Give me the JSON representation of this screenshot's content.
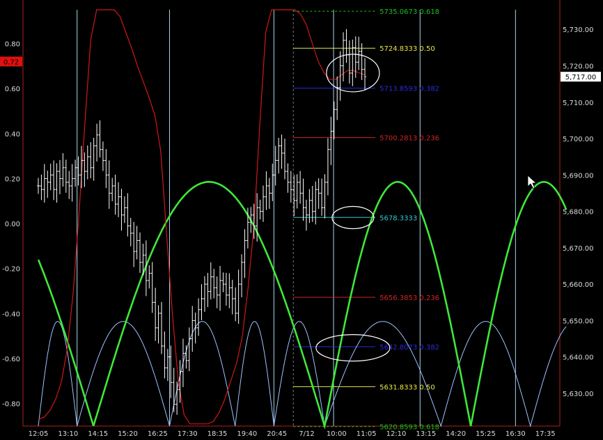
{
  "chart_data": {
    "type": "line",
    "x_tick_labels": [
      "12:05",
      "13:10",
      "14:15",
      "15:20",
      "16:25",
      "17:30",
      "18:35",
      "19:40",
      "20:45",
      "7/12",
      "10:00",
      "11:05",
      "12:10",
      "13:15",
      "14:20",
      "15:25",
      "16:30",
      "17:35"
    ],
    "left_axis": {
      "ticks": [
        -0.8,
        -0.6,
        -0.4,
        -0.2,
        0.0,
        0.2,
        0.4,
        0.6,
        0.8
      ],
      "tick_labels": [
        "-0.80",
        "-0.60",
        "-0.40",
        "-0.20",
        "0.00",
        "0.20",
        "0.40",
        "0.60",
        "0.80"
      ],
      "ylim": [
        -0.9,
        0.95
      ],
      "current_marker": "0.72"
    },
    "right_axis": {
      "ticks": [
        5630,
        5640,
        5650,
        5660,
        5670,
        5680,
        5690,
        5700,
        5710,
        5720,
        5730
      ],
      "tick_labels": [
        "5,630.00",
        "5,640.00",
        "5,650.00",
        "5,660.00",
        "5,670.00",
        "5,680.00",
        "5,690.00",
        "5,700.00",
        "5,710.00",
        "5,720.00",
        "5,730.00"
      ],
      "ylim": [
        5621.0,
        5735.4
      ],
      "current_price_label": "5,717.00",
      "current_price": 5717.0
    },
    "fib_levels": [
      {
        "price": 5735.0,
        "label": "5735.0673 0.618",
        "color": "#19c219",
        "dashed": true
      },
      {
        "price": 5724.8333,
        "label": "5724.8333 0.50",
        "color": "#e8e84a",
        "dashed": false
      },
      {
        "price": 5713.8593,
        "label": "5713.8593 0.382",
        "color": "#2b2bd9",
        "dashed": false
      },
      {
        "price": 5700.2813,
        "label": "5700.2813 0.236",
        "color": "#d42424",
        "dashed": false
      },
      {
        "price": 5678.3333,
        "label": "5678.3333",
        "color": "#34c8d6",
        "dashed": false
      },
      {
        "price": 5656.3853,
        "label": "5656.3853 0.236",
        "color": "#d42424",
        "dashed": false
      },
      {
        "price": 5642.8073,
        "label": "5642.8073 0.382",
        "color": "#2b2bd9",
        "dashed": false
      },
      {
        "price": 5631.8333,
        "label": "5631.8333 0.50",
        "color": "#e8e84a",
        "dashed": false
      },
      {
        "price": 5620.8593,
        "label": "5620.8593 0.618",
        "color": "#19c219",
        "dashed": true
      }
    ],
    "series": [
      {
        "color": "#ffffff",
        "type": "price",
        "values": [
          5687,
          5686,
          5689,
          5688,
          5690,
          5686,
          5691,
          5689,
          5692,
          5688,
          5687,
          5689,
          5692,
          5690,
          5694,
          5691,
          5695,
          5692,
          5698,
          5701,
          5697,
          5694,
          5690,
          5685,
          5687,
          5682,
          5684,
          5679,
          5681,
          5676,
          5674,
          5669,
          5672,
          5666,
          5668,
          5661,
          5663,
          5655,
          5648,
          5652,
          5643,
          5637,
          5640,
          5633,
          5627,
          5631,
          5636,
          5641,
          5639,
          5645,
          5650,
          5648,
          5653,
          5656,
          5660,
          5658,
          5662,
          5659,
          5657,
          5661,
          5660,
          5657,
          5659,
          5656,
          5652,
          5660,
          5666,
          5672,
          5677,
          5679,
          5676,
          5681,
          5680,
          5684,
          5687,
          5685,
          5690,
          5694,
          5698,
          5696,
          5691,
          5688,
          5686,
          5683,
          5688,
          5685,
          5681,
          5679,
          5683,
          5680,
          5686,
          5685,
          5681,
          5688,
          5697,
          5702,
          5708,
          5714,
          5720,
          5727,
          5723,
          5718,
          5725,
          5721,
          5724,
          5719,
          5717
        ],
        "x_start": 0.0,
        "x_end": 10.95
      },
      {
        "color": "#d01818",
        "type": "cycle-oscillator",
        "values": [
          -0.87,
          -0.86,
          -0.83,
          -0.78,
          -0.7,
          -0.55,
          -0.3,
          0.05,
          0.45,
          0.82,
          0.95,
          0.95,
          0.95,
          0.95,
          0.92,
          0.85,
          0.78,
          0.7,
          0.63,
          0.56,
          0.48,
          0.32,
          -0.05,
          -0.4,
          -0.7,
          -0.85,
          -0.89,
          -0.89,
          -0.89,
          -0.89,
          -0.88,
          -0.84,
          -0.78,
          -0.7,
          -0.62,
          -0.5,
          -0.28,
          0.0,
          0.45,
          0.85,
          0.95,
          0.95,
          0.95,
          0.95,
          0.95,
          0.93,
          0.88,
          0.8,
          0.72,
          0.67,
          0.64,
          0.64,
          0.66,
          0.68,
          0.68,
          0.67,
          0.66
        ],
        "x_start": 0.0,
        "x_end": 10.95
      },
      {
        "color": "#3fe83a",
        "type": "long-cycle",
        "x_start": 0.0,
        "x_end": 17.7,
        "amplitude": 0.185,
        "anchors": [
          1.85,
          9.6,
          14.5
        ]
      },
      {
        "color": "#9fc3ff",
        "type": "short-cycle",
        "x_start": 0.0,
        "x_end": 17.7,
        "amplitude": -0.435,
        "anchors": [
          0,
          1.3,
          4.4,
          6.6,
          7.9,
          9.6,
          13.5,
          16.5
        ]
      }
    ],
    "cycle_markers": [
      1.3,
      4.4,
      7.9,
      9.9,
      12.8,
      16.0
    ],
    "grid": false
  }
}
